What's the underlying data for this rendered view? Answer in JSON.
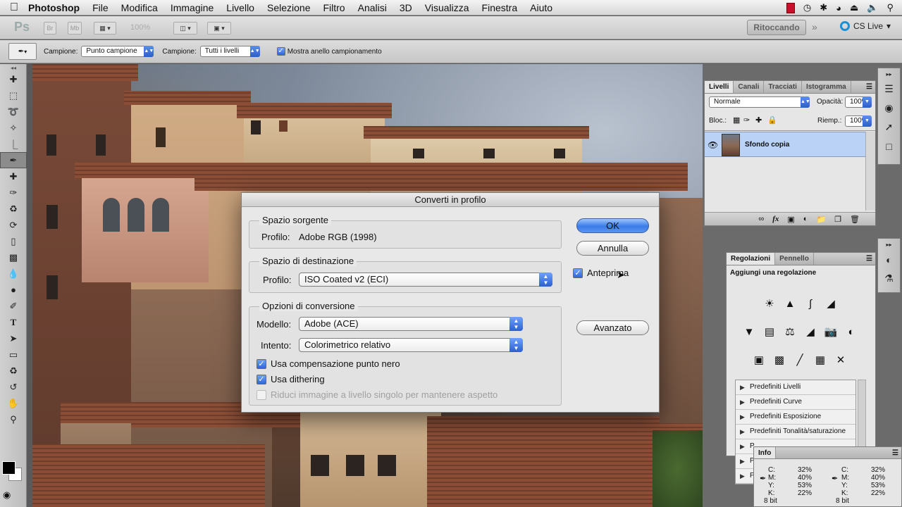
{
  "menubar": {
    "app": "Photoshop",
    "items": [
      "File",
      "Modifica",
      "Immagine",
      "Livello",
      "Selezione",
      "Filtro",
      "Analisi",
      "3D",
      "Visualizza",
      "Finestra",
      "Aiuto"
    ]
  },
  "appbar": {
    "logo": "Ps",
    "br": "Br",
    "mb": "Mb",
    "zoom": "100%",
    "workspace": "Ritoccando",
    "more": "»",
    "cs_live": "CS Live"
  },
  "options": {
    "sample_label": "Campione:",
    "sample_value": "Punto campione",
    "sample2_label": "Campione:",
    "sample2_value": "Tutti i livelli",
    "ring_label": "Mostra anello campionamento"
  },
  "layers_panel": {
    "tabs": [
      "Livelli",
      "Canali",
      "Tracciati",
      "Istogramma"
    ],
    "blend_mode": "Normale",
    "opacity_label": "Opacità:",
    "opacity_value": "100%",
    "lock_label": "Bloc.:",
    "fill_label": "Riemp.:",
    "fill_value": "100%",
    "layer_name": "Sfondo copia"
  },
  "adjustments_panel": {
    "tabs": [
      "Regolazioni",
      "Pennello"
    ],
    "heading": "Aggiungi una regolazione",
    "presets": [
      "Predefiniti Livelli",
      "Predefiniti Curve",
      "Predefiniti Esposizione",
      "Predefiniti Tonalità/saturazione",
      "P",
      "P",
      "P"
    ]
  },
  "info_panel": {
    "title": "Info",
    "left": {
      "c_label": "C:",
      "c": "32%",
      "m_label": "M:",
      "m": "40%",
      "y_label": "Y:",
      "y": "53%",
      "k_label": "K:",
      "k": "22%",
      "bits": "8 bit"
    },
    "right": {
      "c_label": "C:",
      "c": "32%",
      "m_label": "M:",
      "m": "40%",
      "y_label": "Y:",
      "y": "53%",
      "k_label": "K:",
      "k": "22%",
      "bits": "8 bit"
    }
  },
  "dialog": {
    "title": "Converti in profilo",
    "source": {
      "legend": "Spazio sorgente",
      "profile_label": "Profilo:",
      "profile_value": "Adobe RGB (1998)"
    },
    "destination": {
      "legend": "Spazio di destinazione",
      "profile_label": "Profilo:",
      "profile_value": "ISO Coated v2 (ECI)"
    },
    "conversion": {
      "legend": "Opzioni di conversione",
      "engine_label": "Modello:",
      "engine_value": "Adobe (ACE)",
      "intent_label": "Intento:",
      "intent_value": "Colorimetrico relativo",
      "black_point": "Usa compensazione punto nero",
      "dither": "Usa dithering",
      "flatten": "Riduci immagine a livello singolo per mantenere aspetto"
    },
    "ok": "OK",
    "cancel": "Annulla",
    "preview": "Anteprima",
    "advanced": "Avanzato"
  },
  "colors": {
    "accent": "#3a7be6",
    "selection": "#b9d2f5"
  }
}
